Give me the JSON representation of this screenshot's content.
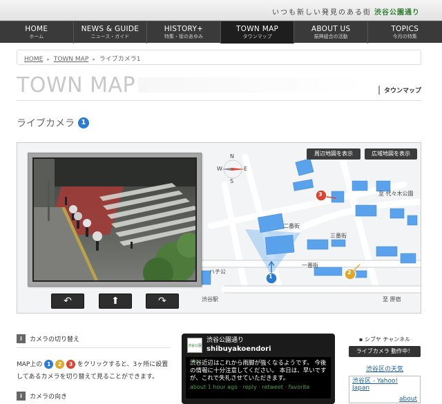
{
  "header": {
    "tagline": "いつも新しい発見のある街",
    "brand": "渋谷公園通り"
  },
  "nav": [
    {
      "label": "HOME",
      "sub": "ホーム"
    },
    {
      "label": "NEWS & GUIDE",
      "sub": "ニュース・ガイド"
    },
    {
      "label": "HISTORY+",
      "sub": "特集・街のあゆみ"
    },
    {
      "label": "TOWN MAP",
      "sub": "タウンマップ"
    },
    {
      "label": "ABOUT US",
      "sub": "振興組合の活動"
    },
    {
      "label": "TOPICS",
      "sub": "今月の特集"
    }
  ],
  "breadcrumb": [
    "HOME",
    "TOWN MAP",
    "ライブカメラ1"
  ],
  "page": {
    "title": "TOWN MAP",
    "subtitle": "タウンマップ",
    "camera_heading": "ライブカメラ",
    "camera_number": "1"
  },
  "map": {
    "btn_nearby": "周辺地図を表示",
    "btn_wide": "広域地図を表示",
    "labels": {
      "yoyogi": "至 代々木公園",
      "nibangai": "二番街",
      "sanbangai": "三番街",
      "ichibangai": "一番街",
      "hachiko": "ハチ公",
      "shibuya_st": "渋谷駅",
      "harajuku": "至 原宿"
    },
    "compass": {
      "n": "N",
      "s": "S",
      "e": "E",
      "w": "W"
    },
    "cameras": [
      "1",
      "2",
      "3"
    ]
  },
  "controls": {
    "back": "↶",
    "up": "⬆",
    "forward": "↷"
  },
  "left": {
    "switch_title": "カメラの切り替え",
    "desc_prefix": "MAP上の",
    "desc_suffix": "をクリックすると、3ヶ所に設置してあるカメラを切り替えて見ることができます。",
    "direction_title": "カメラの向き",
    "info_glyph": "i"
  },
  "twitter": {
    "avatar_text": "渋谷公園通り",
    "name_jp": "渋谷公園通り",
    "handle": "shibuyakoendori",
    "text": "渋谷近辺はこれから雨脚が強くなるようです。 今後の情報に十分注意してください。 本日は、早いですが、これで失礼させていただきます。",
    "meta": "about 1 hour ago · reply · retweet · favorite"
  },
  "right": {
    "channel_label": "シブヤ チャンネル",
    "camera_button": "ライブカメラ 動作中！",
    "weather_link": "渋谷区の天気",
    "weather_text": "渋谷区 - Yahoo! Japan",
    "about": "about"
  },
  "colors": {
    "cam1": "#2a7bd6",
    "cam2": "#e0a82a",
    "cam3": "#d9452f",
    "building": "#5aa2ec",
    "nav_bg": "#3a3a3a",
    "brand_green": "#2f7d2f"
  }
}
